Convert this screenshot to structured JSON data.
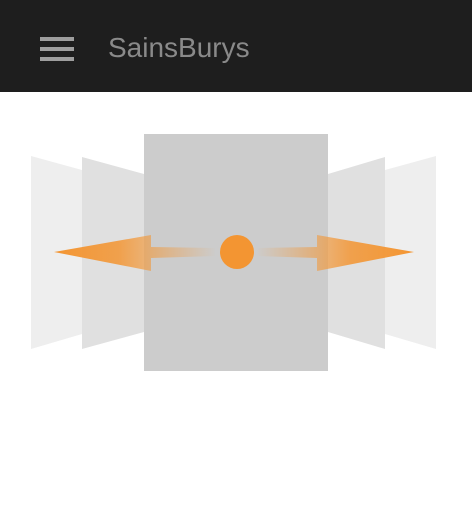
{
  "app_bar": {
    "title": "SainsBurys",
    "menu_icon": "hamburger-menu-icon"
  },
  "main": {
    "illustration": "swipe-gesture-illustration",
    "accent_color": "#f39532",
    "card_colors": {
      "center": "#cccccc",
      "middle": "#e0e0e0",
      "outer": "#eeeeee"
    }
  }
}
